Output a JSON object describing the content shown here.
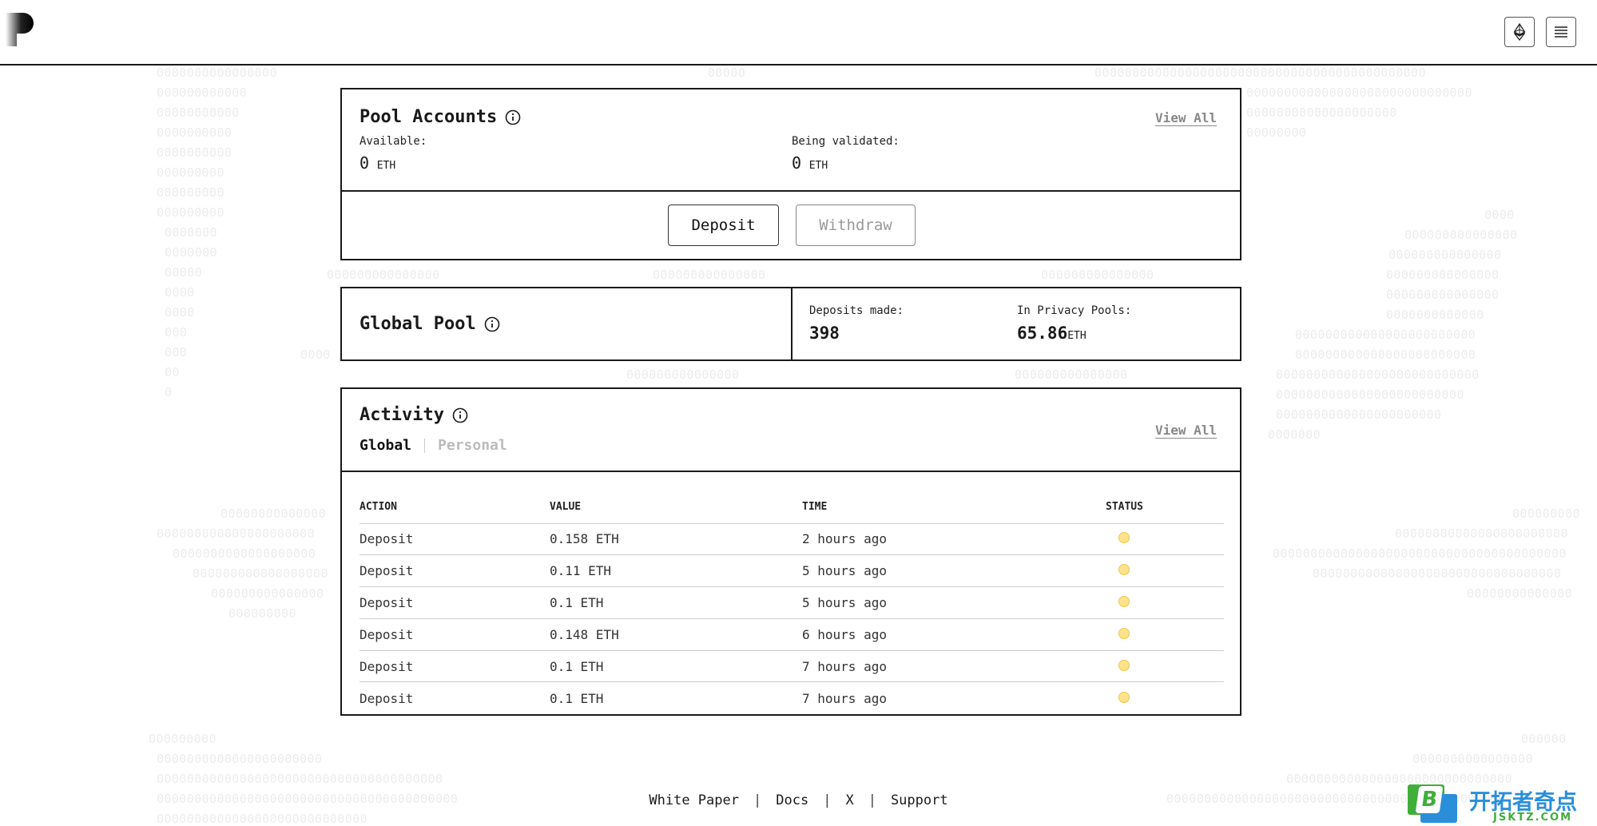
{
  "header": {
    "logo_icon": "privacy-pools-logo",
    "network_icon": "ethereum-icon",
    "menu_icon": "menu-icon"
  },
  "pool_accounts": {
    "title": "Pool Accounts",
    "view_all": "View All",
    "available_label": "Available:",
    "available_value": "0",
    "available_unit": "ETH",
    "validating_label": "Being validated:",
    "validating_value": "0",
    "validating_unit": "ETH",
    "deposit_label": "Deposit",
    "withdraw_label": "Withdraw"
  },
  "global_pool": {
    "title": "Global Pool",
    "deposits_label": "Deposits made:",
    "deposits_value": "398",
    "privacy_label": "In Privacy Pools:",
    "privacy_value": "65.86",
    "privacy_unit": "ETH"
  },
  "activity": {
    "title": "Activity",
    "view_all": "View All",
    "tab_global": "Global",
    "tab_personal": "Personal",
    "columns": {
      "action": "ACTION",
      "value": "VALUE",
      "time": "TIME",
      "status": "STATUS"
    },
    "rows": [
      {
        "action": "Deposit",
        "value": "0.158 ETH",
        "time": "2 hours ago",
        "status": "pending"
      },
      {
        "action": "Deposit",
        "value": "0.11 ETH",
        "time": "5 hours ago",
        "status": "pending"
      },
      {
        "action": "Deposit",
        "value": "0.1 ETH",
        "time": "5 hours ago",
        "status": "pending"
      },
      {
        "action": "Deposit",
        "value": "0.148 ETH",
        "time": "6 hours ago",
        "status": "pending"
      },
      {
        "action": "Deposit",
        "value": "0.1 ETH",
        "time": "7 hours ago",
        "status": "pending"
      },
      {
        "action": "Deposit",
        "value": "0.1 ETH",
        "time": "7 hours ago",
        "status": "pending"
      }
    ],
    "status_color": "#fde38c"
  },
  "footer": {
    "white_paper": "White Paper",
    "docs": "Docs",
    "x": "X",
    "support": "Support",
    "sep": "|"
  },
  "watermark": {
    "text_cn": "开拓者奇点",
    "text_en": "JSKTZ.COM",
    "badge": "B"
  }
}
